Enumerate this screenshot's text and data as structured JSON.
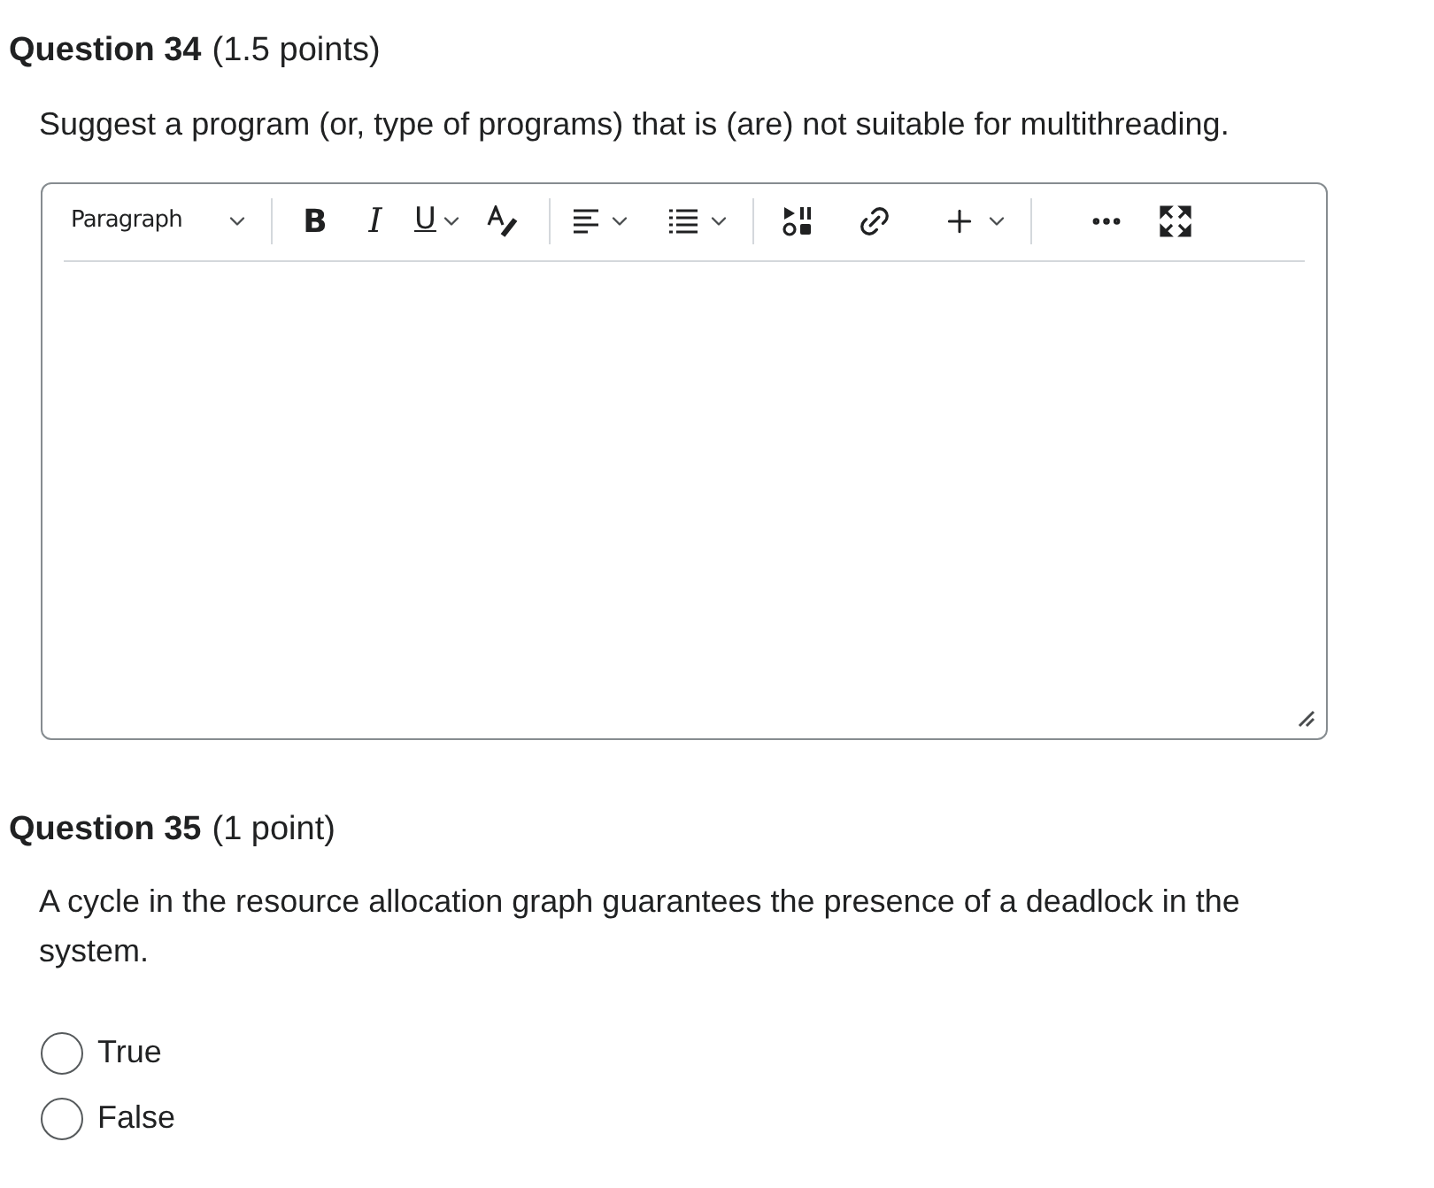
{
  "questions": [
    {
      "kind": "essay",
      "number": "Question 34",
      "points": "(1.5 points)",
      "prompt": "Suggest a program (or, type of programs) that is (are) not suitable for multithreading.",
      "editor": {
        "block_format": "Paragraph",
        "bold": "B",
        "italic": "I",
        "underline": "U"
      }
    },
    {
      "kind": "choice",
      "number": "Question 35",
      "points": "(1 point)",
      "prompt": "A cycle in the resource allocation graph guarantees the presence of a deadlock in the system.",
      "options": [
        {
          "label": "True",
          "selected": false
        },
        {
          "label": "False",
          "selected": false
        }
      ]
    }
  ]
}
